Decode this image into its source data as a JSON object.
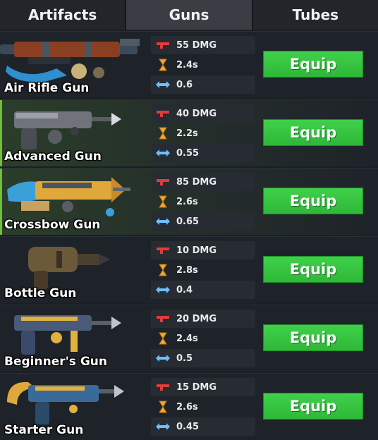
{
  "tabs": [
    {
      "label": "Artifacts",
      "active": false
    },
    {
      "label": "Guns",
      "active": true
    },
    {
      "label": "Tubes",
      "active": false
    }
  ],
  "colors": {
    "equip_green": "#3fd14a",
    "damage_red": "#e23b3b",
    "timer_orange": "#f0a830",
    "range_blue": "#6cc0ff"
  },
  "icons": {
    "damage": "red-gun-icon",
    "time": "hourglass-icon",
    "range": "double-arrow-icon"
  },
  "guns": [
    {
      "name": "Air Rifle Gun",
      "damage": "55 DMG",
      "reload": "2.4s",
      "range": "0.6",
      "button": "Equip"
    },
    {
      "name": "Advanced Gun",
      "damage": "40 DMG",
      "reload": "2.2s",
      "range": "0.55",
      "button": "Equip"
    },
    {
      "name": "Crossbow Gun",
      "damage": "85 DMG",
      "reload": "2.6s",
      "range": "0.65",
      "button": "Equip"
    },
    {
      "name": "Bottle Gun",
      "damage": "10 DMG",
      "reload": "2.8s",
      "range": "0.4",
      "button": "Equip"
    },
    {
      "name": "Beginner's Gun",
      "damage": "20 DMG",
      "reload": "2.4s",
      "range": "0.5",
      "button": "Equip"
    },
    {
      "name": "Starter Gun",
      "damage": "15 DMG",
      "reload": "2.6s",
      "range": "0.45",
      "button": "Equip"
    }
  ]
}
